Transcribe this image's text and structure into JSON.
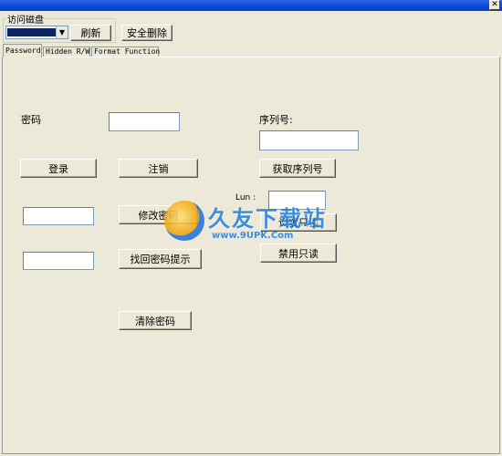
{
  "window": {
    "close_glyph": "✕"
  },
  "drive_group": {
    "label": "访问磁盘",
    "refresh_label": "刷新",
    "safe_remove_label": "安全删除"
  },
  "tabs": [
    {
      "label": "Password"
    },
    {
      "label": "Hidden R/W"
    },
    {
      "label": "Format Function"
    }
  ],
  "password_tab": {
    "password_label": "密码",
    "login_label": "登录",
    "logout_label": "注销",
    "change_password_label": "修改密码",
    "recover_hint_label": "找回密码提示",
    "clear_password_label": "清除密码",
    "serial_label": "序列号:",
    "get_serial_label": "获取序列号",
    "lun_label": "Lun :",
    "set_readonly_label": "设置只读",
    "disable_readonly_label": "禁用只读"
  },
  "watermark": {
    "text": "久友下载站",
    "url": "www.9UPK.Com"
  }
}
